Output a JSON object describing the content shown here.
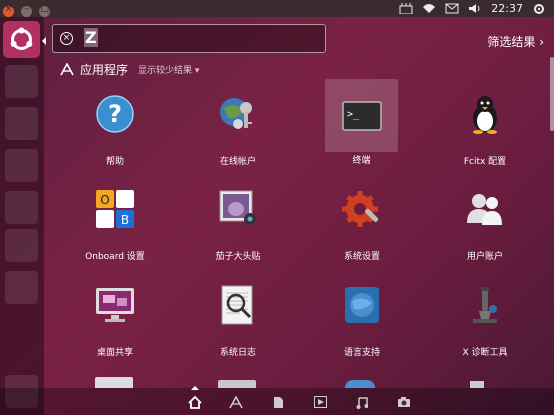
{
  "topbar": {
    "clock": "22:37",
    "window_buttons": [
      "close",
      "minimize",
      "maximize"
    ],
    "indicators": [
      "keyboard-icon",
      "wifi-icon",
      "mail-icon",
      "volume-icon",
      "clock",
      "gear-icon"
    ]
  },
  "search": {
    "value": "Z",
    "clear_icon": "clear-search-icon"
  },
  "filter_label": "筛选结果",
  "category": {
    "title": "应用程序",
    "more_label": "显示较少结果"
  },
  "apps": [
    {
      "label": "帮助",
      "icon": "help-icon"
    },
    {
      "label": "在线帐户",
      "icon": "online-accounts-icon"
    },
    {
      "label": "终端",
      "icon": "terminal-icon",
      "selected": true
    },
    {
      "label": "Fcitx 配置",
      "icon": "fcitx-penguin-icon"
    },
    {
      "label": "Onboard 设置",
      "icon": "onboard-icon"
    },
    {
      "label": "茄子大头贴",
      "icon": "cheese-icon"
    },
    {
      "label": "系统设置",
      "icon": "system-settings-icon"
    },
    {
      "label": "用户账户",
      "icon": "users-icon"
    },
    {
      "label": "桌面共享",
      "icon": "desktop-sharing-icon"
    },
    {
      "label": "系统日志",
      "icon": "system-log-icon"
    },
    {
      "label": "语言支持",
      "icon": "language-support-icon"
    },
    {
      "label": "X 诊断工具",
      "icon": "x-diagnostic-icon"
    }
  ],
  "lenses": [
    "home-lens-icon",
    "apps-lens-icon",
    "files-lens-icon",
    "video-lens-icon",
    "music-lens-icon",
    "photo-lens-icon"
  ],
  "colors": {
    "accent": "#b03060",
    "close_button": "#e2562d"
  }
}
